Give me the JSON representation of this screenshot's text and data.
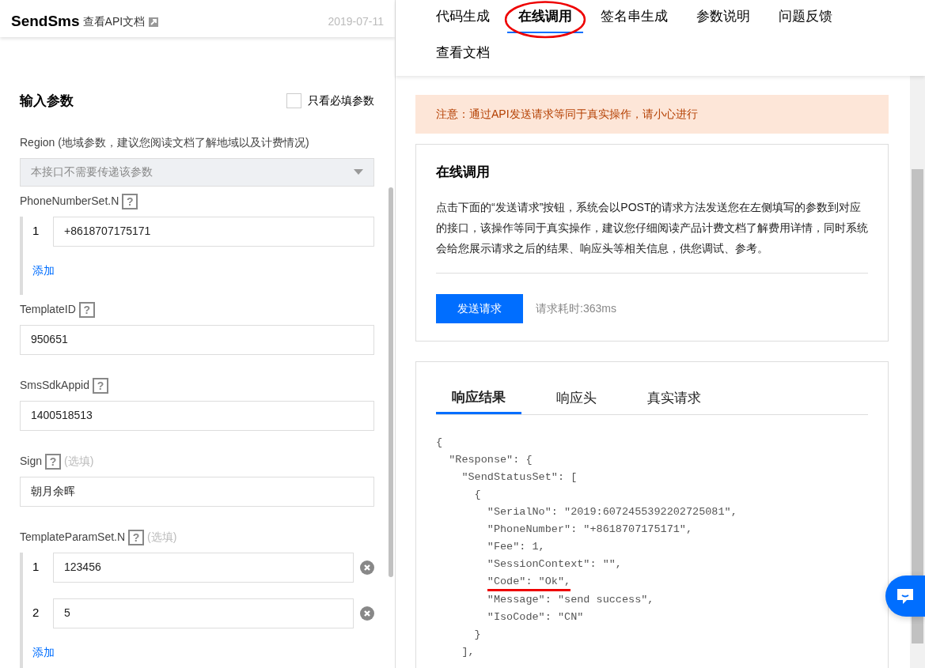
{
  "left": {
    "title": "SendSms",
    "doc_link": "查看API文档",
    "date": "2019-07-11",
    "section_title": "输入参数",
    "required_only": {
      "label": "只看必填参数",
      "checked": false
    },
    "params": [
      {
        "kind": "select",
        "label": "Region (地域参数，建议您阅读文档了解地域以及计费情况)",
        "placeholder": "本接口不需要传递该参数",
        "disabled": true
      },
      {
        "kind": "list",
        "label": "PhoneNumberSet.N",
        "help": "?",
        "items": [
          {
            "index": "1",
            "value": "+8618707175171",
            "removable": false
          }
        ],
        "add_label": "添加"
      },
      {
        "kind": "text",
        "label": "TemplateID",
        "help": "?",
        "value": "950651"
      },
      {
        "kind": "text",
        "label": "SmsSdkAppid",
        "help": "?",
        "value": "1400518513"
      },
      {
        "kind": "text",
        "label": "Sign",
        "help": "?",
        "optional_note": "(选填)",
        "value": "朝月余晖"
      },
      {
        "kind": "list",
        "label": "TemplateParamSet.N",
        "help": "?",
        "optional_note": "(选填)",
        "items": [
          {
            "index": "1",
            "value": "123456",
            "removable": true
          },
          {
            "index": "2",
            "value": "5",
            "removable": true
          }
        ],
        "add_label": "添加"
      }
    ]
  },
  "right": {
    "tabs": [
      {
        "label": "代码生成",
        "selected": false,
        "circled": false
      },
      {
        "label": "在线调用",
        "selected": true,
        "circled": true
      },
      {
        "label": "签名串生成",
        "selected": false,
        "circled": false
      },
      {
        "label": "参数说明",
        "selected": false,
        "circled": false
      },
      {
        "label": "问题反馈",
        "selected": false,
        "circled": false
      },
      {
        "label": "查看文档",
        "selected": false,
        "circled": false
      }
    ],
    "notice": "注意：通过API发送请求等同于真实操作，请小心进行",
    "call_card": {
      "title": "在线调用",
      "description": "点击下面的“发送请求”按钮，系统会以POST的请求方法发送您在左侧填写的参数到对应的接口，该操作等同于真实操作，建议您仔细阅读产品计费文档了解费用详情，同时系统会给您展示请求之后的结果、响应头等相关信息，供您调试、参考。",
      "button": "发送请求",
      "timing": "请求耗时:363ms"
    },
    "response": {
      "tabs": [
        {
          "label": "响应结果",
          "selected": true
        },
        {
          "label": "响应头",
          "selected": false
        },
        {
          "label": "真实请求",
          "selected": false
        }
      ],
      "lines": [
        {
          "text": "{",
          "underlined": false
        },
        {
          "text": "  ″Response″: {",
          "underlined": false
        },
        {
          "text": "    ″SendStatusSet″: [",
          "underlined": false
        },
        {
          "text": "      {",
          "underlined": false
        },
        {
          "text": "        ″SerialNo″: ″2019:6072455392202725081″,",
          "underlined": false
        },
        {
          "text": "        ″PhoneNumber″: ″+8618707175171″,",
          "underlined": false
        },
        {
          "text": "        ″Fee″: 1,",
          "underlined": false
        },
        {
          "text": "        ″SessionContext″: ″″,",
          "underlined": false
        },
        {
          "text": "        ″Code″: ″Ok″,",
          "underlined": true
        },
        {
          "text": "        ″Message″: ″send success″,",
          "underlined": false
        },
        {
          "text": "        ″IsoCode″: ″CN″",
          "underlined": false
        },
        {
          "text": "      }",
          "underlined": false
        },
        {
          "text": "    ],",
          "underlined": false
        }
      ]
    }
  }
}
